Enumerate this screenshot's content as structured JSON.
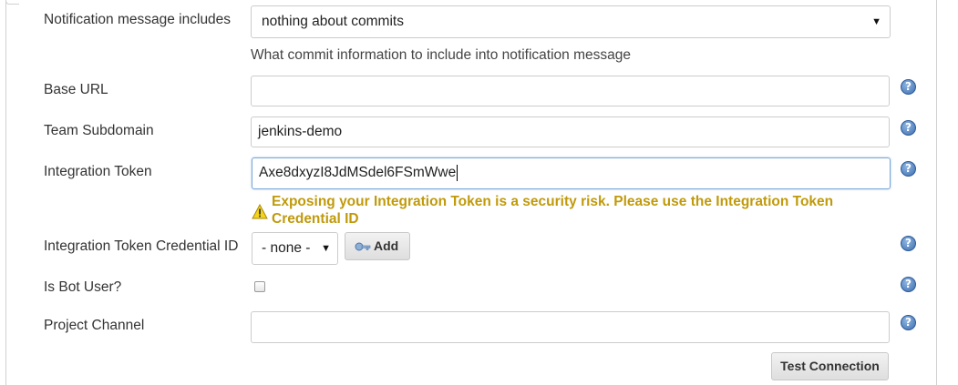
{
  "notification": {
    "label": "Notification message includes",
    "selected": "nothing about commits",
    "hint": "What commit information to include into notification message"
  },
  "base_url": {
    "label": "Base URL",
    "value": ""
  },
  "team_subdomain": {
    "label": "Team Subdomain",
    "value": "jenkins-demo"
  },
  "integration_token": {
    "label": "Integration Token",
    "value": "Axe8dxyzI8JdMSdel6FSmWwe",
    "warning": "Exposing your Integration Token is a security risk. Please use the Integration Token Credential ID"
  },
  "credential": {
    "label": "Integration Token Credential ID",
    "selected": "- none -",
    "add_label": "Add"
  },
  "bot_user": {
    "label": "Is Bot User?",
    "checked": false
  },
  "project_channel": {
    "label": "Project Channel",
    "value": ""
  },
  "test_button": {
    "label": "Test Connection"
  },
  "help_glyph": "?",
  "colors": {
    "warning": "#c09a0b",
    "help": "#3f6fae",
    "focus_border": "#7aa7d9"
  },
  "icons": {
    "help": "help-icon",
    "warning": "warning-icon",
    "key": "key-icon",
    "dropdown": "chevron-down-icon"
  }
}
